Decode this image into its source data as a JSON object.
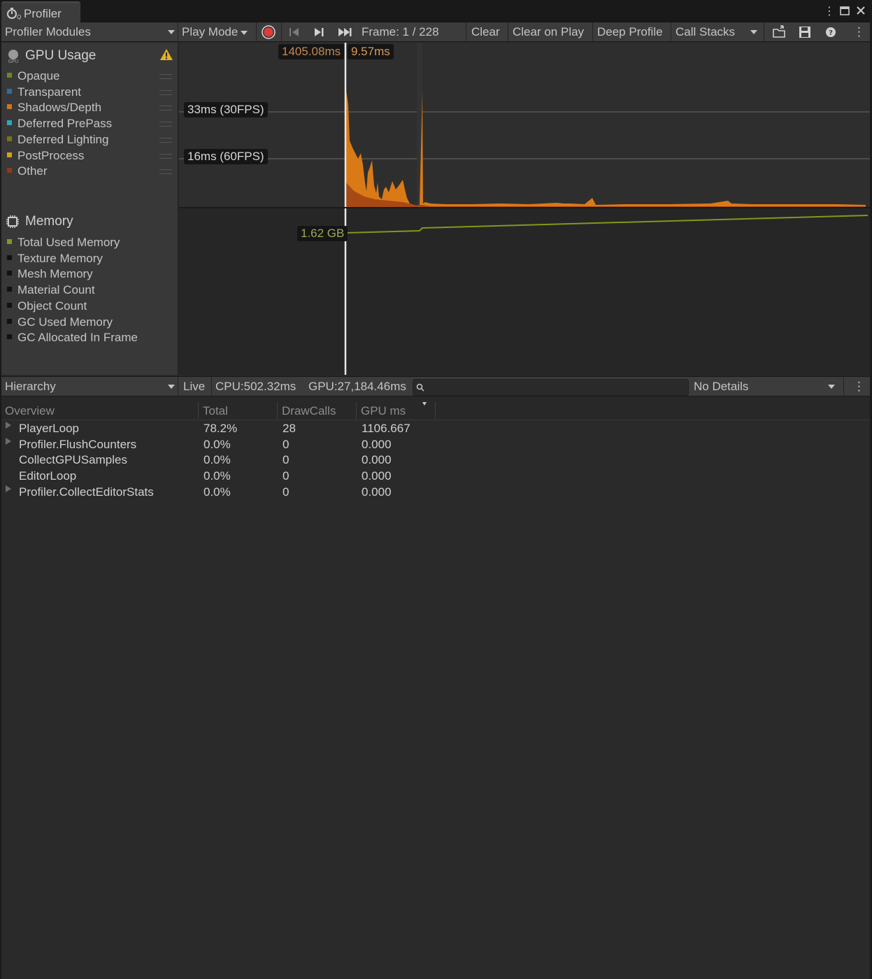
{
  "window": {
    "tab_title": "Profiler",
    "icons": [
      "profiler-tab-icon",
      "kebab-menu-icon",
      "maximize-icon",
      "close-icon"
    ]
  },
  "toolbar": {
    "modules_label": "Profiler Modules",
    "play_mode_label": "Play Mode",
    "frame_label": "Frame: 1 / 228",
    "clear_label": "Clear",
    "clear_on_play_label": "Clear on Play",
    "deep_profile_label": "Deep Profile",
    "call_stacks_label": "Call Stacks"
  },
  "gpu_module": {
    "title": "GPU Usage",
    "legend": [
      {
        "label": "Opaque",
        "color": "#6a8a1c"
      },
      {
        "label": "Transparent",
        "color": "#2a6fa8"
      },
      {
        "label": "Shadows/Depth",
        "color": "#d2731b"
      },
      {
        "label": "Deferred PrePass",
        "color": "#2ea7b8"
      },
      {
        "label": "Deferred Lighting",
        "color": "#7a7417"
      },
      {
        "label": "PostProcess",
        "color": "#d4a017"
      },
      {
        "label": "Other",
        "color": "#8f3a17"
      }
    ],
    "selected_time_label": "1405.08ms",
    "selected_value_label": "9.57ms",
    "line_30fps_label": "33ms (30FPS)",
    "line_60fps_label": "16ms (60FPS)"
  },
  "memory_module": {
    "title": "Memory",
    "legend": [
      {
        "label": "Total Used Memory",
        "color": "#7f9a1b"
      },
      {
        "label": "Texture Memory",
        "color": "#111111"
      },
      {
        "label": "Mesh Memory",
        "color": "#111111"
      },
      {
        "label": "Material Count",
        "color": "#111111"
      },
      {
        "label": "Object Count",
        "color": "#111111"
      },
      {
        "label": "GC Used Memory",
        "color": "#111111"
      },
      {
        "label": "GC Allocated In Frame",
        "color": "#111111"
      }
    ],
    "value_label": "1.62 GB"
  },
  "hierarchy": {
    "view_label": "Hierarchy",
    "live_label": "Live",
    "cpu_label": "CPU:502.32ms",
    "gpu_label": "GPU:27,184.46ms",
    "search_placeholder": "",
    "details_label": "No Details"
  },
  "table": {
    "columns": [
      "Overview",
      "Total",
      "DrawCalls",
      "GPU ms"
    ],
    "rows": [
      {
        "name": "PlayerLoop",
        "total": "78.2%",
        "drawcalls": "28",
        "gpu_ms": "1106.667",
        "expandable": true
      },
      {
        "name": "Profiler.FlushCounters",
        "total": "0.0%",
        "drawcalls": "0",
        "gpu_ms": "0.000",
        "expandable": true
      },
      {
        "name": "CollectGPUSamples",
        "total": "0.0%",
        "drawcalls": "0",
        "gpu_ms": "0.000",
        "expandable": false
      },
      {
        "name": "EditorLoop",
        "total": "0.0%",
        "drawcalls": "0",
        "gpu_ms": "0.000",
        "expandable": false
      },
      {
        "name": "Profiler.CollectEditorStats",
        "total": "0.0%",
        "drawcalls": "0",
        "gpu_ms": "0.000",
        "expandable": true
      }
    ]
  },
  "colors": {
    "accent_orange": "#d97a17",
    "memory_line": "#7f9a1b",
    "record_red": "#e03a3a",
    "warning_yellow": "#e4b21a"
  }
}
